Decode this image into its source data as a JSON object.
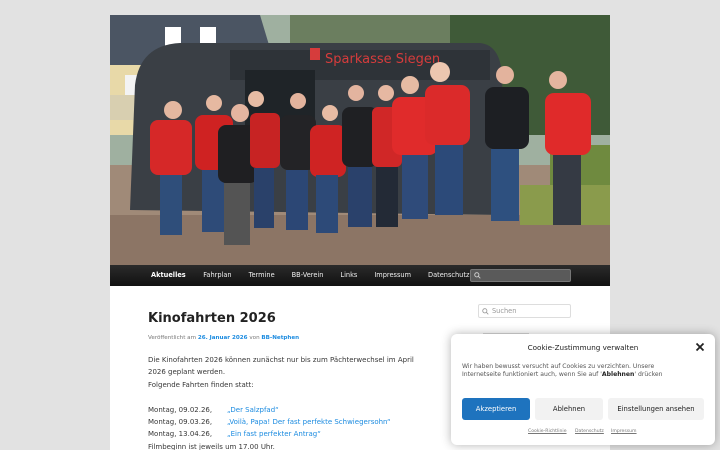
{
  "header": {
    "photo_alt": "Gruppenfoto vor dem Kleinbus",
    "bus_text": "Sparkasse Siegen"
  },
  "nav": {
    "items": [
      "Aktuelles",
      "Fahrplan",
      "Termine",
      "BB-Verein",
      "Links",
      "Impressum",
      "Datenschutz"
    ],
    "search_placeholder": ""
  },
  "article": {
    "title": "Kinofahrten 2026",
    "meta_prefix": "Veröffentlicht am ",
    "meta_date": "26. Januar 2026",
    "meta_mid": " von ",
    "meta_author": "BB-Netphen",
    "intro_1": "Die Kinofahrten 2026 können zunächst nur bis zum Pächterwechsel im April",
    "intro_2": "2026 geplant werden.",
    "intro_3": "Folgende Fahrten finden statt:",
    "rows": [
      {
        "date": "Montag, 09.02.26,",
        "film": "„Der Salzpfad“"
      },
      {
        "date": "Montag, 09.03.26,",
        "film": "„Voilà, Papa! Der fast perfekte Schwiegersohn“"
      },
      {
        "date": "Montag, 13.04.26,",
        "film": "„Ein fast perfekter Antrag“"
      }
    ],
    "footer_line": "Filmbeginn ist jeweils um 17.00 Uhr."
  },
  "sidebar": {
    "search_placeholder": "Suchen"
  },
  "cookie": {
    "title": "Cookie-Zustimmung verwalten",
    "text_1": "Wir haben bewusst versucht auf Cookies zu verzichten. Unsere",
    "text_2a": "Internetseite funktioniert auch, wenn Sie auf '",
    "text_2b": "Ablehnen",
    "text_2c": "' drücken",
    "accept": "Akzeptieren",
    "deny": "Ablehnen",
    "settings": "Einstellungen ansehen",
    "link_cookie": "Cookie-Richtlinie",
    "link_privacy": "Datenschutz",
    "link_imprint": "Impressum"
  },
  "colors": {
    "link": "#1b8be0",
    "accept_button": "#1e73be",
    "nav_bg": "#1a1a1a"
  }
}
